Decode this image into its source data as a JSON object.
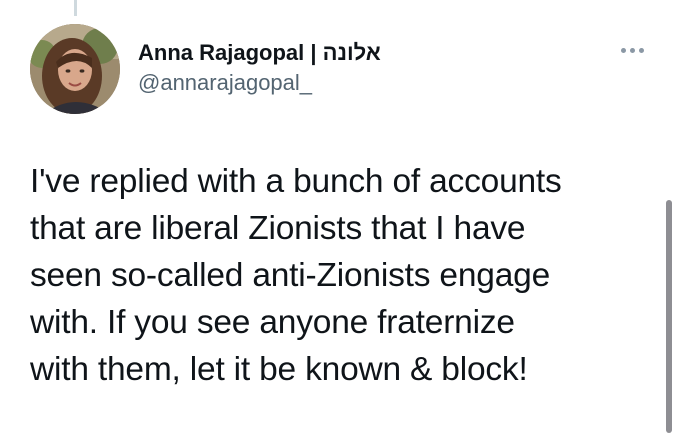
{
  "author": {
    "display_name": "Anna Rajagopal | אלונה",
    "handle": "@annarajagopal_"
  },
  "more_icon": "more-horizontal-icon",
  "tweet_text_lines": [
    "I've replied with a bunch of accounts",
    "that are liberal Zionists that I have",
    "seen so-called anti-Zionists engage",
    "with. If you see anyone fraternize",
    "with them, let it be known & block!"
  ],
  "colors": {
    "text": "#0f1419",
    "secondary": "#536471",
    "thread_line": "#cfd9de",
    "scrollbar": "#8e8e93"
  }
}
